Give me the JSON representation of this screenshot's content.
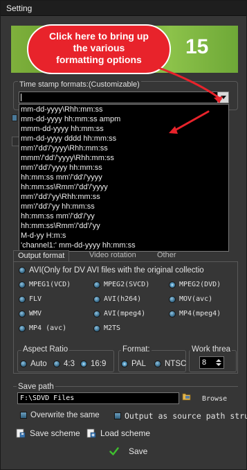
{
  "window": {
    "title": "Setting"
  },
  "banner": {
    "number": "15"
  },
  "callout": {
    "line1": "Click here to bring up",
    "line2": "the various",
    "line3": "formatting options"
  },
  "timestamp": {
    "label": "Time stamp formats:(Customizable)",
    "value": "",
    "options": [
      "mm-dd-yyyy\\Rhh:mm:ss",
      "mm-dd-yyyy hh:mm:ss ampm",
      "mmm-dd-yyyy hh:mm:ss",
      "mm-dd-yyyy dddd hh:mm:ss",
      "mm'/'dd'/'yyyy\\Rhh:mm:ss",
      "mmm'/'dd'/'yyyy\\Rhh:mm:ss",
      "mm'/'dd'/'yyyy hh:mm:ss",
      "hh:mm:ss mm'/'dd'/'yyyy",
      "hh:mm:ss\\Rmm'/'dd'/'yyyy",
      "mm'/'dd'/'yy\\Rhh:mm:ss",
      "mm'/'dd'/'yy hh:mm:ss",
      "hh:mm:ss mm'/'dd'/'yy",
      "hh:mm:ss\\Rmm'/'dd'/'yy",
      "M-d-yy H:m:s",
      "'channel1:'         mm-dd-yyyy hh:mm:ss"
    ]
  },
  "tabs": [
    "Output format",
    "Video rotation",
    "Other"
  ],
  "output_formats": {
    "avi_note": "AVI(Only for DV AVI files with the original collectio",
    "options": [
      "MPEG1(VCD)",
      "MPEG2(SVCD)",
      "MPEG2(DVD)",
      "FLV",
      "AVI(h264)",
      "MOV(avc)",
      "WMV",
      "AVI(mpeg4)",
      "MP4(mpeg4)",
      "MP4 (avc)",
      "M2TS"
    ],
    "selected": "MPEG2(DVD)"
  },
  "aspect_ratio": {
    "label": "Aspect Ratio",
    "options": [
      "Auto",
      "4:3",
      "16:9"
    ],
    "selected": "16:9"
  },
  "format": {
    "label": "Format:",
    "options": [
      "PAL",
      "NTSC"
    ],
    "selected": "PAL"
  },
  "work_thread": {
    "label": "Work threa",
    "value": "8"
  },
  "save_path": {
    "label": "Save path",
    "value": "F:\\SDVD Files",
    "browse_label": "Browse",
    "overwrite_label": "Overwrite the same",
    "source_path_label": "Output as source path struc"
  },
  "actions": {
    "save_scheme": "Save scheme",
    "load_scheme": "Load scheme",
    "save": "Save"
  },
  "colors": {
    "accent": "#e8232b",
    "banner": "#7fb03c",
    "radio": "#3b6f8f"
  }
}
